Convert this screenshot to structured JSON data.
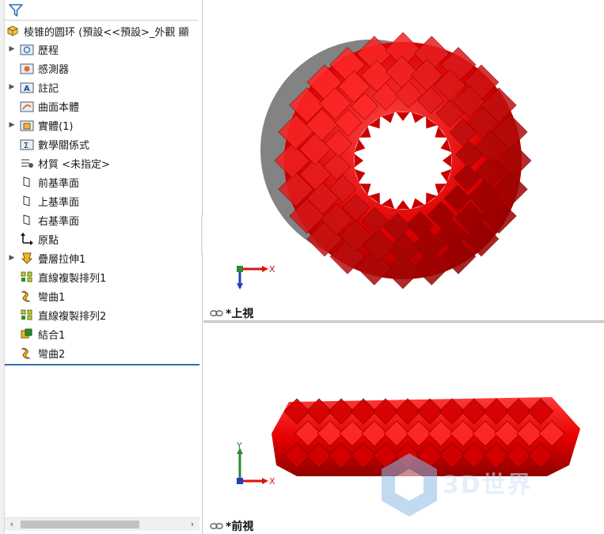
{
  "tree": {
    "root_label": "棱锥的圆环 (預設<<預設>_外觀 顯",
    "items": [
      {
        "label": "歷程",
        "icon": "history-folder-icon",
        "expandable": true
      },
      {
        "label": "感測器",
        "icon": "sensor-folder-icon",
        "expandable": false
      },
      {
        "label": "註記",
        "icon": "annotation-folder-icon",
        "expandable": true
      },
      {
        "label": "曲面本體",
        "icon": "surface-bodies-folder-icon",
        "expandable": false
      },
      {
        "label": "實體(1)",
        "icon": "solid-bodies-folder-icon",
        "expandable": true
      },
      {
        "label": "數學關係式",
        "icon": "equations-folder-icon",
        "expandable": false
      },
      {
        "label": "材質 <未指定>",
        "icon": "material-icon",
        "expandable": false
      },
      {
        "label": "前基準面",
        "icon": "plane-icon",
        "expandable": false
      },
      {
        "label": "上基準面",
        "icon": "plane-icon",
        "expandable": false
      },
      {
        "label": "右基準面",
        "icon": "plane-icon",
        "expandable": false
      },
      {
        "label": "原點",
        "icon": "origin-icon",
        "expandable": false
      },
      {
        "label": "疊層拉伸1",
        "icon": "loft-icon",
        "expandable": true
      },
      {
        "label": "直線複製排列1",
        "icon": "linear-pattern-icon",
        "expandable": false
      },
      {
        "label": "彎曲1",
        "icon": "flex-icon",
        "expandable": false
      },
      {
        "label": "直線複製排列2",
        "icon": "linear-pattern-icon",
        "expandable": false
      },
      {
        "label": "結合1",
        "icon": "combine-icon",
        "expandable": false
      },
      {
        "label": "彎曲2",
        "icon": "flex-icon",
        "expandable": false
      }
    ]
  },
  "viewports": {
    "top": {
      "label": "*上視",
      "axis_x": "X"
    },
    "front": {
      "label": "*前視",
      "axis_x": "X",
      "axis_y": "Y"
    }
  },
  "watermark": "3D世界"
}
